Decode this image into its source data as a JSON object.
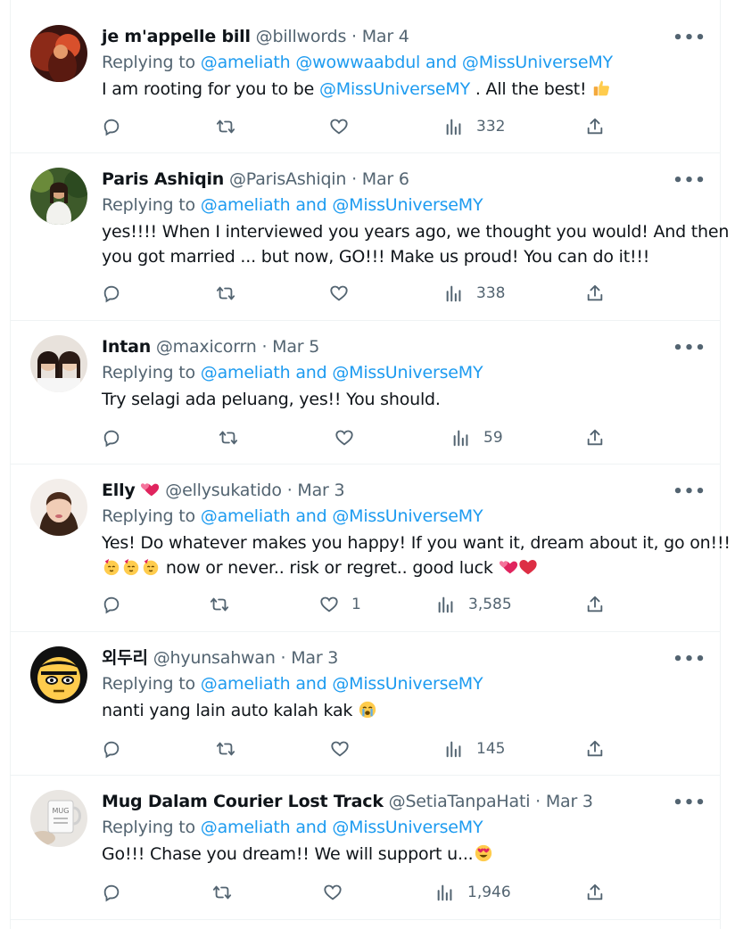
{
  "colors": {
    "accent": "#1d9bf0",
    "muted": "#536471",
    "text": "#0f1419",
    "border": "#eff3f4"
  },
  "tweets": [
    {
      "name": "je m'appelle bill",
      "handle": "@billwords",
      "sep": "·",
      "date": "Mar 4",
      "reply_prefix": "Replying to",
      "reply_mentions": "@ameliath @wowwaabdul and @MissUniverseMY",
      "text_before": "I am rooting for you to be ",
      "text_mention": "@MissUniverseMY",
      "text_after": " . All the best! ",
      "emoji": [
        "thumbs-up"
      ],
      "likes": "",
      "views": "332",
      "avatar": "avatar-red-portrait"
    },
    {
      "name": "Paris Ashiqin",
      "handle": "@ParisAshiqin",
      "sep": "·",
      "date": "Mar 6",
      "reply_prefix": "Replying to",
      "reply_mentions": "@ameliath and @MissUniverseMY",
      "text_line1": "yes!!!! When I interviewed you years ago, we thought you would! And then",
      "text_line2": "you got married ... but now, GO!!! Make us proud! You can do it!!!",
      "likes": "",
      "views": "338",
      "avatar": "avatar-garden-portrait"
    },
    {
      "name": "Intan",
      "handle": "@maxicorrn",
      "sep": "·",
      "date": "Mar 5",
      "reply_prefix": "Replying to",
      "reply_mentions": "@ameliath and @MissUniverseMY",
      "text": "Try selagi ada peluang, yes!! You should.",
      "likes": "",
      "views": "59",
      "avatar": "avatar-two-girls"
    },
    {
      "name": "Elly",
      "name_emoji": "two-hearts",
      "handle": "@ellysukatido",
      "sep": "·",
      "date": "Mar 3",
      "reply_prefix": "Replying to",
      "reply_mentions": "@ameliath and @MissUniverseMY",
      "text_line1": "Yes! Do whatever makes you happy! If you want it, dream about it, go on!!!",
      "text_line2": " now or never.. risk or regret.. good luck ",
      "likes": "1",
      "views": "3,585",
      "avatar": "avatar-woman-selfie"
    },
    {
      "name": "외두리",
      "handle": "@hyunsahwan",
      "sep": "·",
      "date": "Mar 3",
      "reply_prefix": "Replying to",
      "reply_mentions": "@ameliath and @MissUniverseMY",
      "text": "nanti yang lain auto kalah kak ",
      "likes": "",
      "views": "145",
      "avatar": "avatar-emoji-face"
    },
    {
      "name": "Mug Dalam Courier Lost Track",
      "handle": "@SetiaTanpaHati",
      "sep": "·",
      "date": "Mar 3",
      "reply_prefix": "Replying to",
      "reply_mentions": "@ameliath and @MissUniverseMY",
      "text": "Go!!! Chase you dream!! We will support u...",
      "likes": "",
      "views": "1,946",
      "avatar": "avatar-mug",
      "avatar_text": "MUG"
    }
  ]
}
